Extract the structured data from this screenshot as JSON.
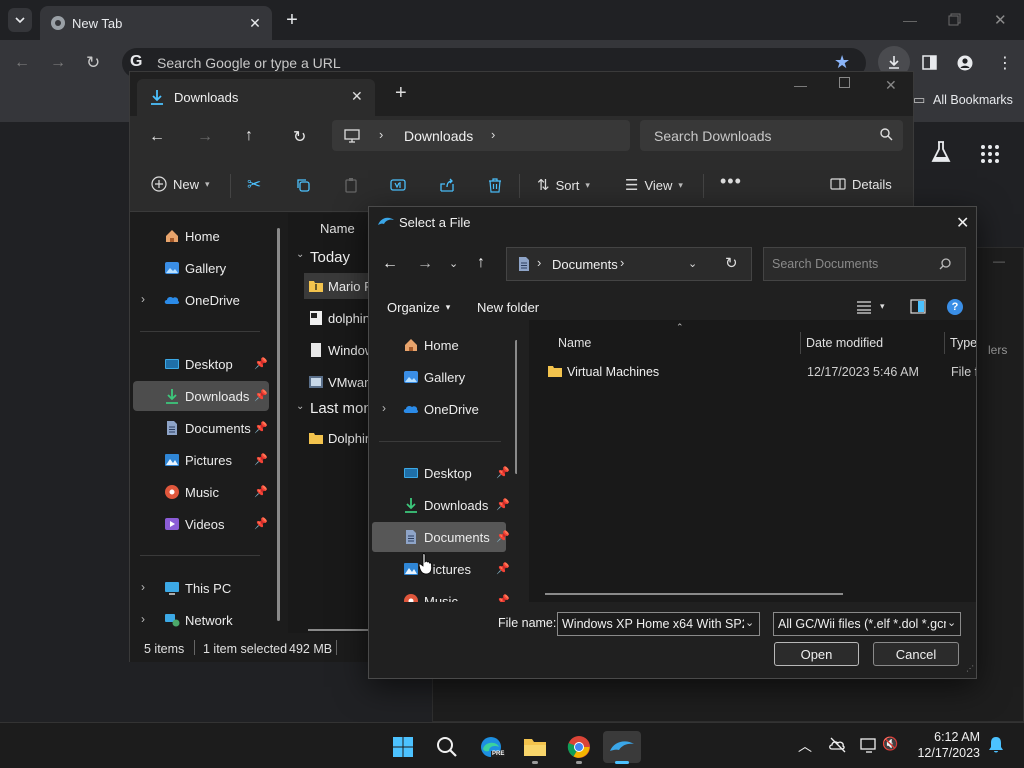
{
  "chrome": {
    "tab_title": "New Tab",
    "omnibox_placeholder": "Search Google or type a URL",
    "bookmarks_label": "All Bookmarks",
    "partial_label": "lers"
  },
  "explorer": {
    "tab_title": "Downloads",
    "breadcrumb": "Downloads",
    "search_placeholder": "Search Downloads",
    "commands": {
      "new": "New",
      "sort": "Sort",
      "view": "View",
      "details": "Details"
    },
    "nav": {
      "home": "Home",
      "gallery": "Gallery",
      "onedrive": "OneDrive",
      "desktop": "Desktop",
      "downloads": "Downloads",
      "documents": "Documents",
      "pictures": "Pictures",
      "music": "Music",
      "videos": "Videos",
      "thispc": "This PC",
      "network": "Network"
    },
    "column_name": "Name",
    "groups": {
      "today": "Today",
      "last_month": "Last mon"
    },
    "files": [
      "Mario P",
      "dolphin",
      "Window",
      "VMware",
      "Dolphin"
    ],
    "status": {
      "items": "5 items",
      "selected": "1 item selected",
      "size": "492 MB"
    }
  },
  "dialog": {
    "title": "Select a File",
    "breadcrumb": "Documents",
    "search_placeholder": "Search Documents",
    "organize": "Organize",
    "new_folder": "New folder",
    "nav": {
      "home": "Home",
      "gallery": "Gallery",
      "onedrive": "OneDrive",
      "desktop": "Desktop",
      "downloads": "Downloads",
      "documents": "Documents",
      "pictures": "Pictures",
      "music": "Music"
    },
    "columns": {
      "name": "Name",
      "date": "Date modified",
      "type": "Type"
    },
    "rows": [
      {
        "name": "Virtual Machines",
        "date": "12/17/2023 5:46 AM",
        "type": "File fo"
      }
    ],
    "filename_label": "File name:",
    "filename_value": "Windows XP Home x64 With SP2 \\",
    "filter_value": "All GC/Wii files (*.elf *.dol *.gcr",
    "open": "Open",
    "cancel": "Cancel"
  },
  "taskbar": {
    "time": "6:12 AM",
    "date": "12/17/2023",
    "edge_badge": "PRE"
  },
  "colors": {
    "accent": "#4cc2ff",
    "selected_bg": "#4d4d4d",
    "folder": "#f3c34d"
  }
}
